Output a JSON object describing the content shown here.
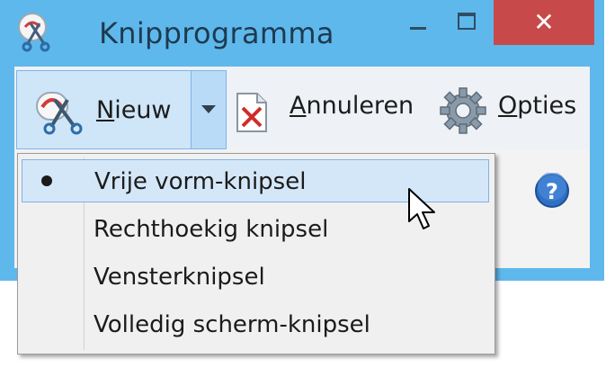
{
  "window": {
    "title": "Knipprogramma",
    "close_glyph": "✕"
  },
  "toolbar": {
    "new_label_accel": "N",
    "new_label_rest": "ieuw",
    "cancel_label_accel": "A",
    "cancel_label_rest": "nnuleren",
    "options_label_accel": "O",
    "options_label_rest": "pties"
  },
  "menu": {
    "items": [
      {
        "label": "Vrije vorm-knipsel",
        "checked": true
      },
      {
        "label": "Rechthoekig knipsel",
        "checked": false
      },
      {
        "label": "Vensterknipsel",
        "checked": false
      },
      {
        "label": "Volledig scherm-knipsel",
        "checked": false
      }
    ]
  },
  "icons": {
    "app": "scissors-icon",
    "new": "scissors-icon",
    "cancel": "document-x-icon",
    "options": "gear-icon",
    "help": "help-icon",
    "cursor": "mouse-pointer-icon"
  },
  "colors": {
    "frame": "#5fb8ec",
    "close": "#c7494a",
    "selection": "#d4e7f8",
    "selection_border": "#7fb3e6"
  }
}
